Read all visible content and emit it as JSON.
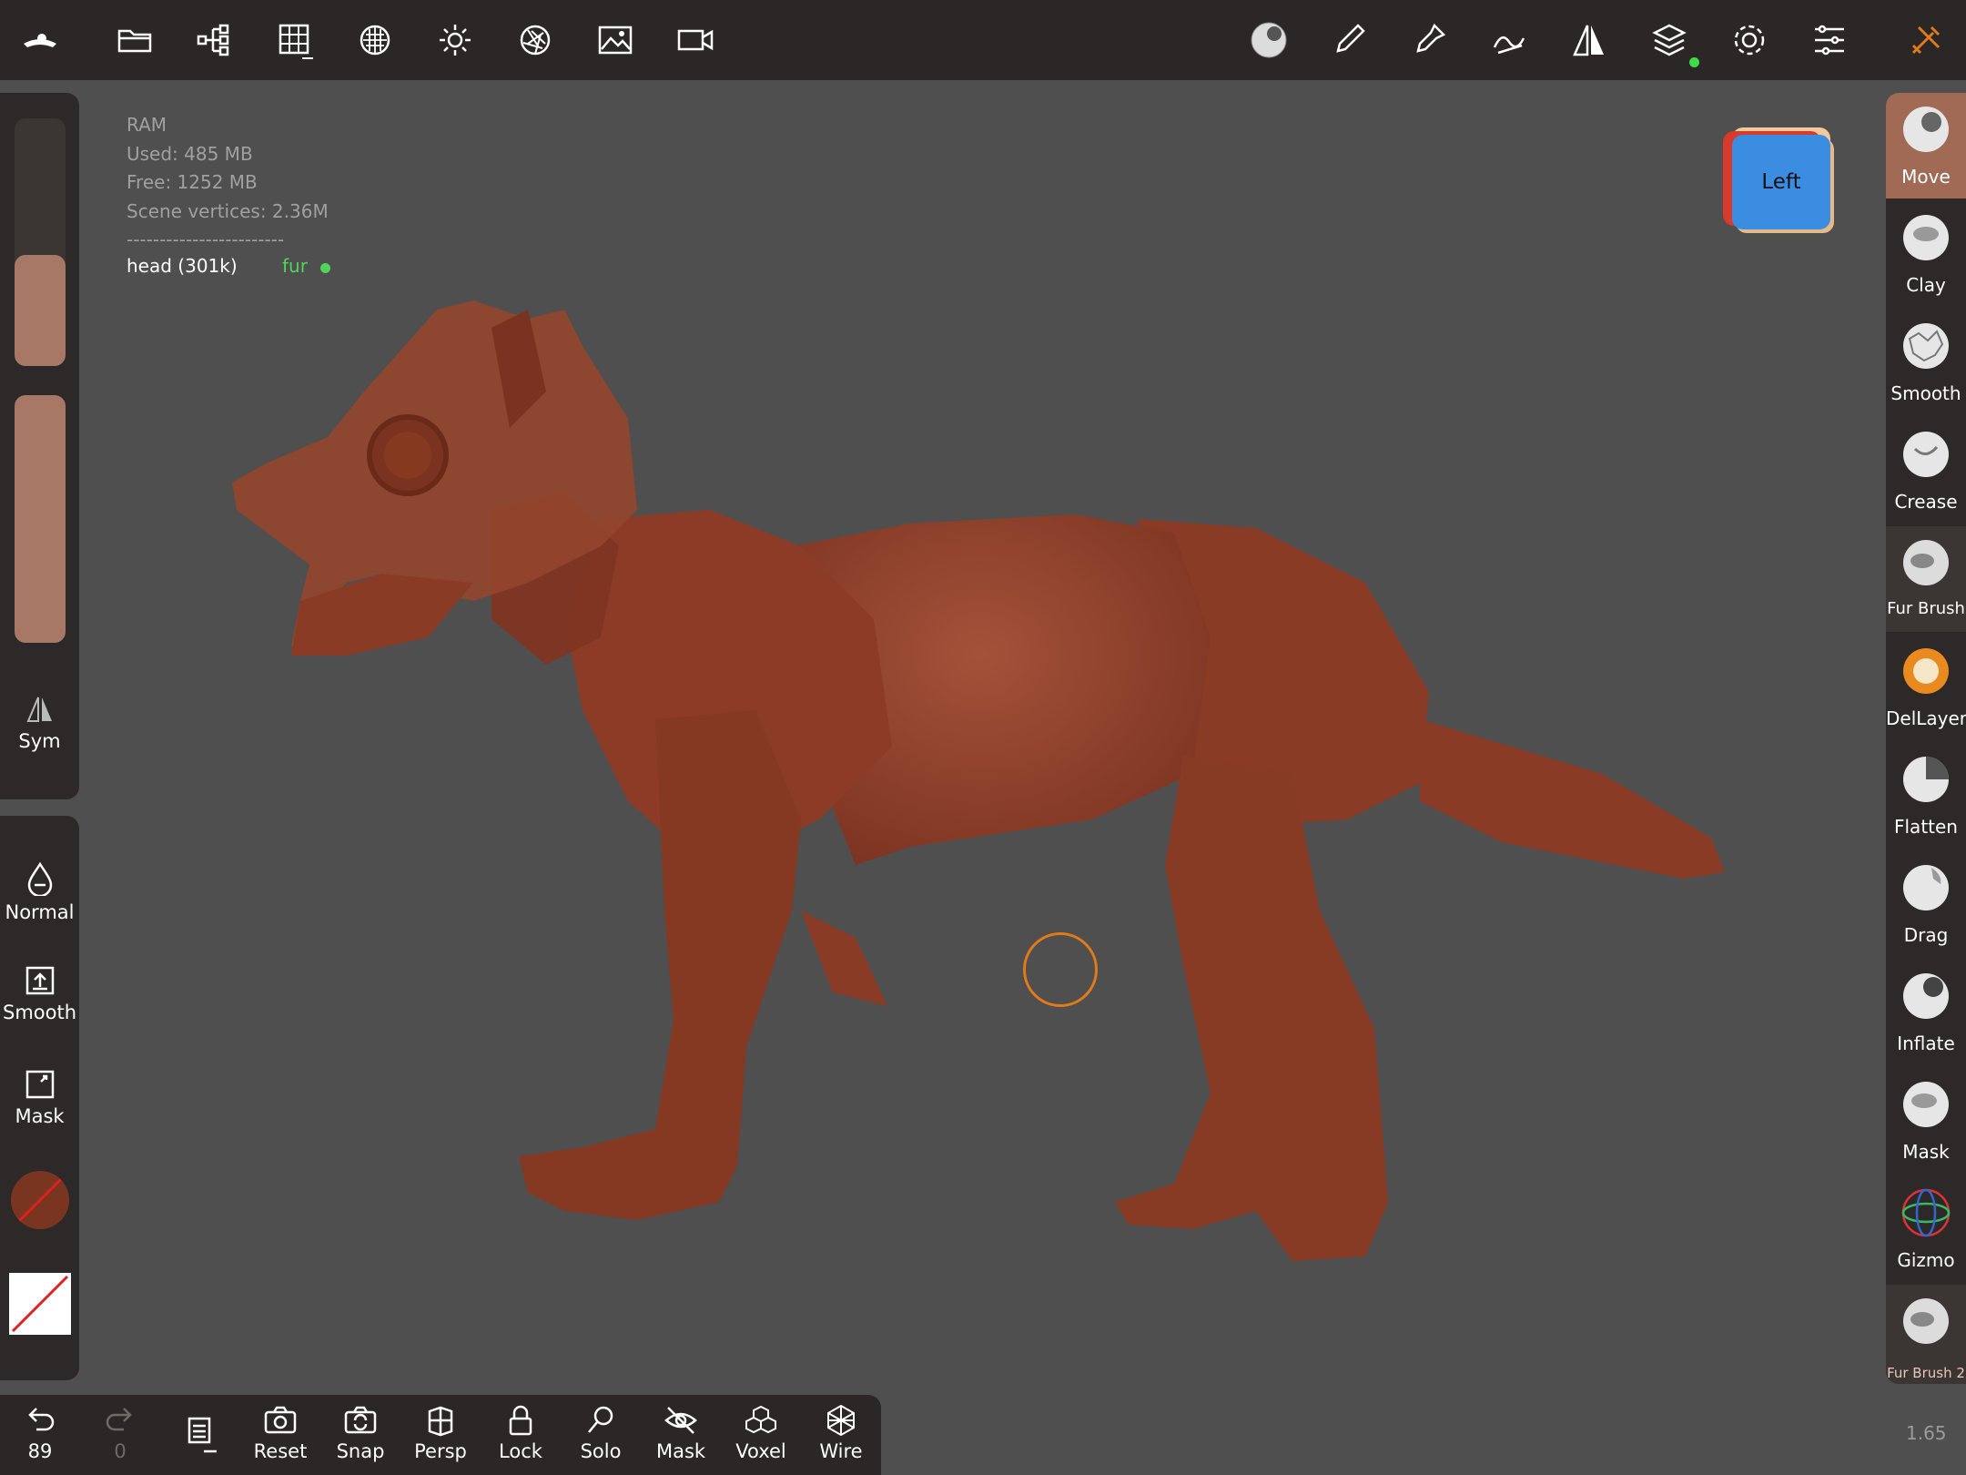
{
  "toolbar": {
    "left_icons": [
      "nomad-logo-icon",
      "folder-icon",
      "scene-tree-icon",
      "grid-icon",
      "topology-icon",
      "light-icon",
      "camera-aperture-icon",
      "image-icon",
      "video-icon"
    ],
    "right_icons": [
      "material-sphere-icon",
      "paint-brush-icon",
      "stamp-icon",
      "stroke-icon",
      "symmetry-icon",
      "layers-icon",
      "settings-icon",
      "sliders-icon",
      "tools-icon"
    ]
  },
  "left_panel": {
    "sym_label": "Sym",
    "normal_label": "Normal",
    "smooth_label": "Smooth",
    "mask_label": "Mask",
    "color_swatch": "#7a3520",
    "radius_fraction": 0.45,
    "intensity_fraction": 1.0
  },
  "info": {
    "ram_label": "RAM",
    "used": "Used: 485 MB",
    "free": "Free: 1252 MB",
    "vertices": "Scene vertices: 2.36M",
    "divider": "------------------------",
    "mesh": "head (301k)",
    "layer": "fur"
  },
  "viewcube": {
    "label": "Left"
  },
  "brushes": [
    {
      "label": "Move",
      "state": "active"
    },
    {
      "label": "Clay",
      "state": "normal"
    },
    {
      "label": "Smooth",
      "state": "normal"
    },
    {
      "label": "Crease",
      "state": "normal"
    },
    {
      "label": "Fur Brush",
      "state": "dim"
    },
    {
      "label": "DelLayer",
      "state": "normal"
    },
    {
      "label": "Flatten",
      "state": "normal"
    },
    {
      "label": "Drag",
      "state": "normal"
    },
    {
      "label": "Inflate",
      "state": "normal"
    },
    {
      "label": "Mask",
      "state": "normal"
    },
    {
      "label": "Gizmo",
      "state": "normal"
    },
    {
      "label": "Fur Brush 2",
      "state": "dim"
    }
  ],
  "bottombar": {
    "undo_count": "89",
    "redo_count": "0",
    "reset": "Reset",
    "snap": "Snap",
    "persp": "Persp",
    "lock": "Lock",
    "solo": "Solo",
    "mask": "Mask",
    "voxel": "Voxel",
    "wire": "Wire"
  },
  "zoom": "1.65",
  "colors": {
    "accent": "#a06a55",
    "model": "#8e3f28",
    "background": "#4f4f4f",
    "cursor": "#e07a1a"
  }
}
